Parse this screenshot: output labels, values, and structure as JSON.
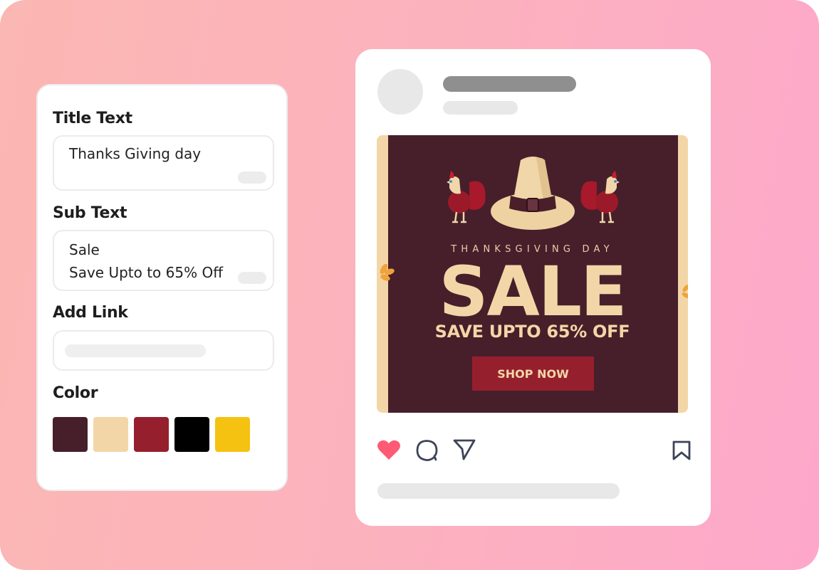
{
  "editor": {
    "title_label": "Title Text",
    "title_value": "Thanks Giving day",
    "subtext_label": "Sub Text",
    "subtext_value": "Sale\nSave Upto to 65% Off",
    "link_label": "Add Link",
    "link_value": "",
    "color_label": "Color",
    "colors": [
      {
        "name": "maroon",
        "hex": "#461f2b"
      },
      {
        "name": "cream",
        "hex": "#f3d6a7"
      },
      {
        "name": "crimson",
        "hex": "#961f2e"
      },
      {
        "name": "black",
        "hex": "#000000"
      },
      {
        "name": "yellow",
        "hex": "#f5c211"
      }
    ]
  },
  "post": {
    "banner": {
      "kicker": "THANKSGIVING DAY",
      "headline": "SALE",
      "subline": "SAVE UPTO 65% OFF",
      "cta": "SHOP NOW"
    },
    "actions": {
      "like": "heart-icon",
      "comment": "comment-icon",
      "share": "send-icon",
      "save": "bookmark-icon",
      "liked": true,
      "like_color": "#fe5a74",
      "icon_color": "#3d4459"
    }
  }
}
